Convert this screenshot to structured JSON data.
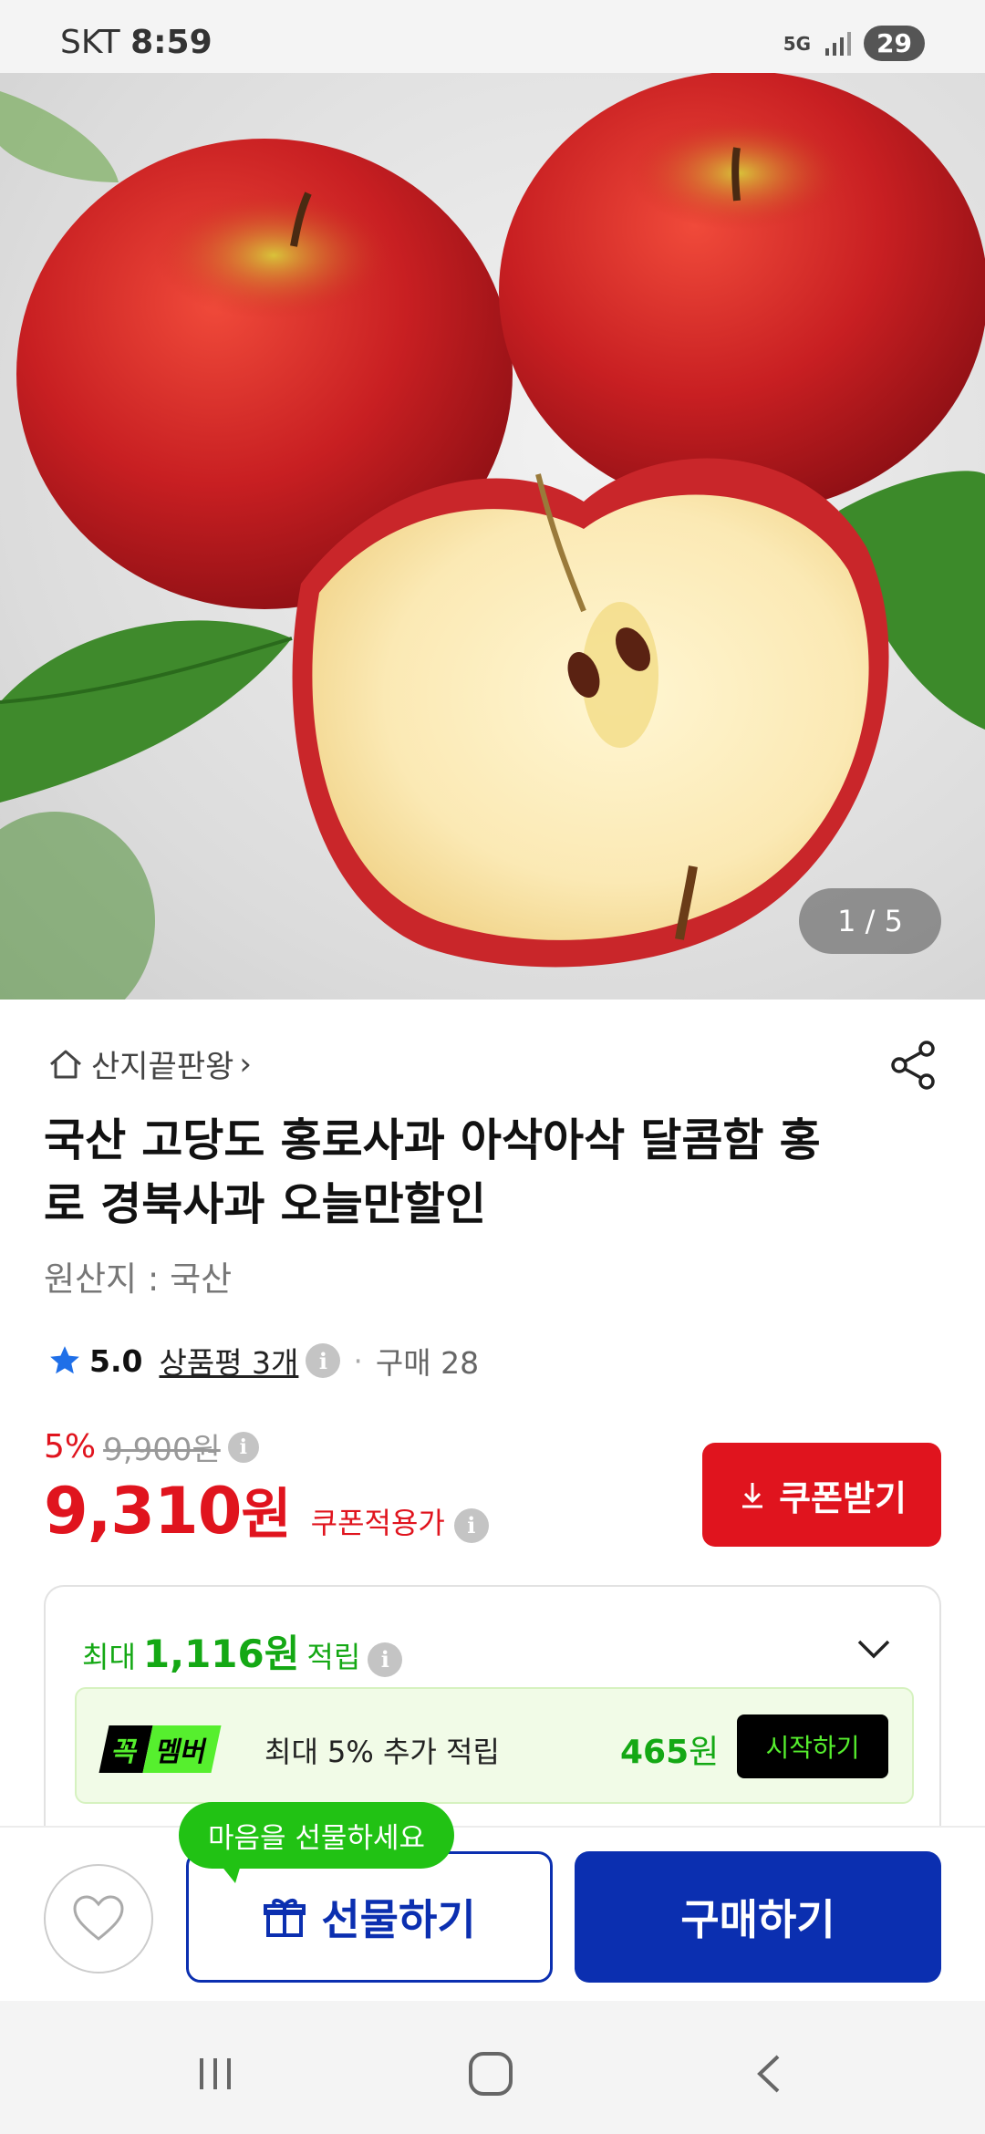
{
  "status_bar": {
    "carrier": "SKT",
    "time": "8:59",
    "network": "5G",
    "battery": "29"
  },
  "gallery": {
    "counter": "1 / 5"
  },
  "store": {
    "name": "산지끝판왕",
    "arrow": "›"
  },
  "product": {
    "title": "국산 고당도 홍로사과 아삭아삭 달콤함 홍로 경북사과 오늘만할인",
    "origin": "원산지 : 국산"
  },
  "rating": {
    "score": "5.0",
    "reviews": "상품평 3개",
    "separator": "·",
    "purchases": "구매 28"
  },
  "price": {
    "discount_rate": "5%",
    "original": "9,900",
    "original_unit": "원",
    "final": "9,310",
    "final_unit": "원",
    "coupon_label": "쿠폰적용가",
    "coupon_button": "쿠폰받기"
  },
  "reward": {
    "prefix": "최대",
    "amount": "1,116원",
    "suffix": "적립",
    "member_badge_k": "꼭",
    "member_badge_m": "멤버",
    "member_text": "최대 5% 추가 적립",
    "member_amount": "465",
    "member_amount_unit": "원",
    "start_button": "시작하기"
  },
  "bottom": {
    "tooltip": "마음을 선물하세요",
    "gift_button": "선물하기",
    "buy_button": "구매하기"
  },
  "colors": {
    "accent_red": "#e0141e",
    "accent_blue": "#0b2fb0",
    "accent_green": "#14a814",
    "member_green": "#56ef2e"
  }
}
